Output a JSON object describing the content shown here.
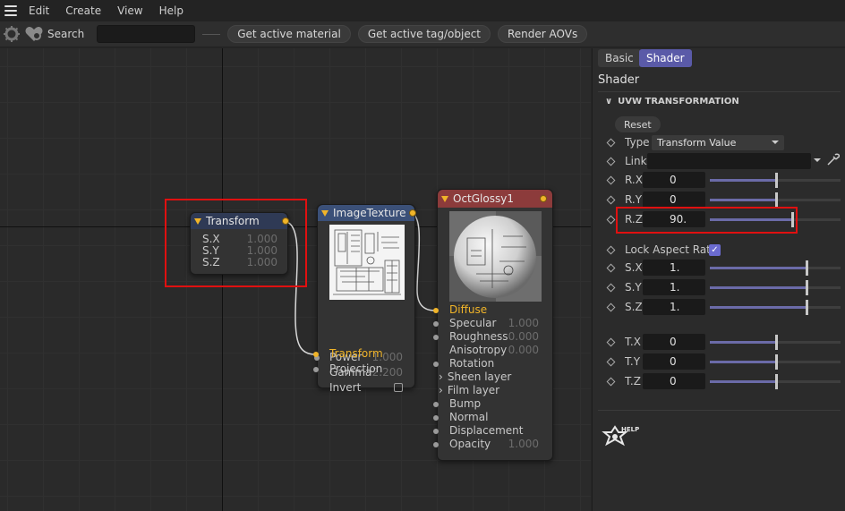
{
  "menu": [
    "Edit",
    "Create",
    "View",
    "Help"
  ],
  "toolbar": {
    "search_label": "Search",
    "search_value": "",
    "buttons": [
      "Get active material",
      "Get active tag/object",
      "Render AOVs"
    ]
  },
  "nodes": {
    "transform": {
      "title": "Transform",
      "rows": [
        {
          "label": "S.X",
          "value": "1.000"
        },
        {
          "label": "S.Y",
          "value": "1.000"
        },
        {
          "label": "S.Z",
          "value": "1.000"
        }
      ]
    },
    "image_texture": {
      "title": "ImageTexture",
      "rows": [
        {
          "label": "Power",
          "value": "1.000"
        },
        {
          "label": "Gamma",
          "value": "2.200"
        },
        {
          "label": "Invert",
          "value": ""
        },
        {
          "label": "Transform",
          "value": ""
        },
        {
          "label": "Projection",
          "value": ""
        }
      ]
    },
    "oct_glossy": {
      "title": "OctGlossy1",
      "rows": [
        {
          "label": "Diffuse",
          "value": ""
        },
        {
          "label": "Specular",
          "value": "1.000"
        },
        {
          "label": "Roughness",
          "value": "0.000"
        },
        {
          "label": "Anisotropy",
          "value": "0.000"
        },
        {
          "label": "Rotation",
          "value": ""
        },
        {
          "label": "Sheen layer",
          "value": ""
        },
        {
          "label": "Film layer",
          "value": ""
        },
        {
          "label": "Bump",
          "value": ""
        },
        {
          "label": "Normal",
          "value": ""
        },
        {
          "label": "Displacement",
          "value": ""
        },
        {
          "label": "Opacity",
          "value": "1.000"
        }
      ]
    }
  },
  "panel": {
    "tabs": [
      "Basic",
      "Shader"
    ],
    "active_tab": "Shader",
    "heading": "Shader",
    "section": "UVW TRANSFORMATION",
    "reset_label": "Reset",
    "type_label": "Type",
    "type_value": "Transform Value",
    "link_label": "Link",
    "link_value": "",
    "rows": [
      {
        "label": "R.X",
        "value": "0",
        "level": 0.5
      },
      {
        "label": "R.Y",
        "value": "0",
        "level": 0.5
      },
      {
        "label": "R.Z",
        "value": "90.",
        "level": 0.62
      },
      {
        "label": "S.X",
        "value": "1.",
        "level": 0.73
      },
      {
        "label": "S.Y",
        "value": "1.",
        "level": 0.73
      },
      {
        "label": "S.Z",
        "value": "1.",
        "level": 0.73
      },
      {
        "label": "T.X",
        "value": "0",
        "level": 0.5
      },
      {
        "label": "T.Y",
        "value": "0",
        "level": 0.5
      },
      {
        "label": "T.Z",
        "value": "0",
        "level": 0.5
      }
    ],
    "lock_aspect_label": "Lock Aspect Ratio",
    "lock_aspect_checked": true,
    "help_label": "HELP"
  },
  "colors": {
    "accent": "#f0b429",
    "tab_active": "#5a5aa8",
    "glossy_header": "#8c3b3b",
    "texture_header": "#3b5078",
    "transform_header": "#2f3a55",
    "slider_fill": "#6b6ba8",
    "highlight": "#e01010"
  }
}
